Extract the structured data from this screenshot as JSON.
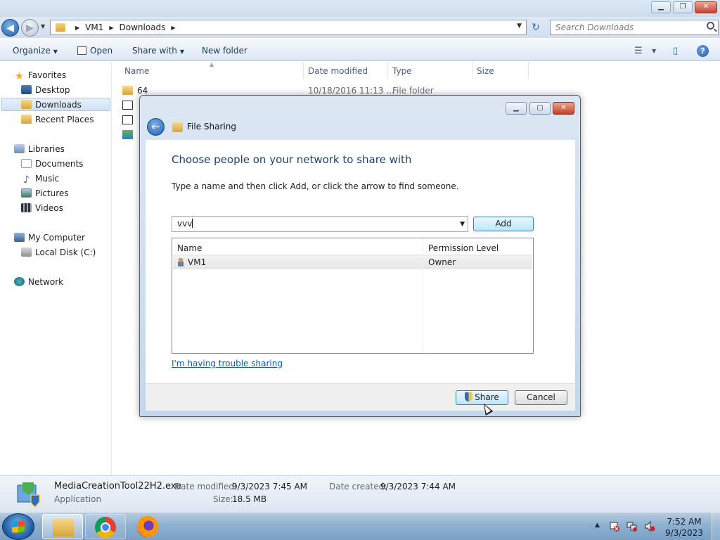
{
  "explorer": {
    "address": {
      "crumbs": [
        "VM1",
        "Downloads"
      ]
    },
    "search": {
      "placeholder": "Search Downloads"
    },
    "toolbar": {
      "organize": "Organize",
      "open": "Open",
      "share_with": "Share with",
      "new_folder": "New folder"
    },
    "nav": {
      "favorites": "Favorites",
      "desktop": "Desktop",
      "downloads": "Downloads",
      "recent_places": "Recent Places",
      "libraries": "Libraries",
      "documents": "Documents",
      "music": "Music",
      "pictures": "Pictures",
      "videos": "Videos",
      "my_computer": "My Computer",
      "local_disk": "Local Disk (C:)",
      "network": "Network"
    },
    "columns": {
      "name": "Name",
      "date_modified": "Date modified",
      "type": "Type",
      "size": "Size"
    },
    "files": [
      {
        "name": "64",
        "date_modified": "10/18/2016 11:13 ...",
        "type": "File folder"
      }
    ],
    "details": {
      "filename": "MediaCreationTool22H2.exe",
      "type": "Application",
      "date_modified_label": "Date modified:",
      "date_modified": "9/3/2023 7:45 AM",
      "date_created_label": "Date created:",
      "date_created": "9/3/2023 7:44 AM",
      "size_label": "Size:",
      "size": "18.5 MB"
    }
  },
  "dialog": {
    "title": "File Sharing",
    "heading": "Choose people on your network to share with",
    "instructions": "Type a name and then click Add, or click the arrow to find someone.",
    "input_value": "vvv",
    "add_label": "Add",
    "columns": {
      "name": "Name",
      "permission": "Permission Level"
    },
    "rows": [
      {
        "name": "VM1",
        "permission": "Owner"
      }
    ],
    "trouble_link": "I'm having trouble sharing",
    "share_label": "Share",
    "cancel_label": "Cancel"
  },
  "taskbar": {
    "time": "7:52 AM",
    "date": "9/3/2023"
  },
  "icons": {
    "back": "back-arrow-icon",
    "forward": "forward-arrow-icon",
    "search": "search-icon",
    "help": "help-icon",
    "uac_shield": "uac-shield-icon"
  }
}
